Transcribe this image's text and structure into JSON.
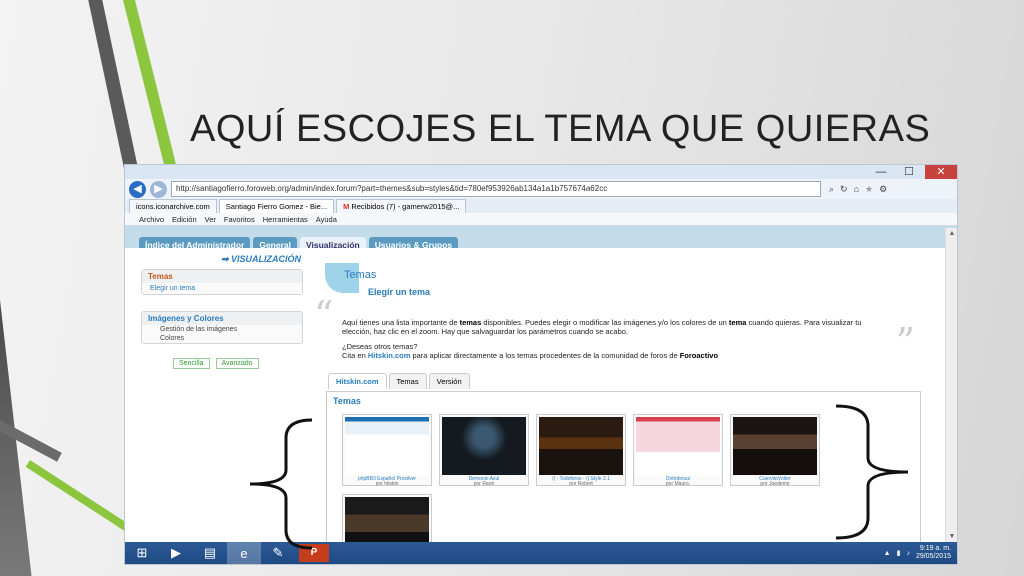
{
  "slide": {
    "title": "AQUÍ ESCOJES EL TEMA QUE QUIERAS"
  },
  "browser": {
    "window_controls": {
      "minimize": "—",
      "maximize": "☐",
      "close": "✕"
    },
    "url": "http://santiagofierro.foroweb.org/admin/index.forum?part=themes&sub=styles&tid=780ef953926ab134a1a1b757674a62cc",
    "tabs": [
      {
        "label": "icons.iconarchive.com",
        "active": false
      },
      {
        "label": "Santiago Fierro Gomez - Bie...",
        "active": true
      },
      {
        "label": "Recibidos (7) - gamerw2015@...",
        "active": false
      }
    ],
    "menu": [
      "Archivo",
      "Edición",
      "Ver",
      "Favoritos",
      "Herramientas",
      "Ayuda"
    ]
  },
  "admin": {
    "tabs": [
      "Índice del Administrador",
      "General",
      "Visualización",
      "Usuarios & Grupos"
    ],
    "active_tab": "Visualización",
    "sidebar": {
      "section": "➡ VISUALIZACIÓN",
      "group1": {
        "title": "Temas",
        "items": [
          "Elegir un tema"
        ]
      },
      "group2": {
        "title": "Imágenes y Colores",
        "items": [
          "Gestión de las imágenes",
          "Colores"
        ]
      },
      "modes": [
        "Sencilla",
        "Avanzado"
      ]
    },
    "content": {
      "title": "Temas",
      "subtitle": "Elegir un tema",
      "para1_a": "Aquí tienes una lista importante de ",
      "para1_b": "temas",
      "para1_c": " disponibles. Puedes elegir o modificar las imágenes y/o los colores de un ",
      "para1_d": "tema",
      "para1_e": " cuando quieras. Para visualizar tu elección, haz clic en el zoom. Hay que salvaguardar los parámetros cuando se acabo.",
      "para2_line1": "¿Deseas otros temas?",
      "para2_a": "Cita en ",
      "para2_b": "Hitskin.com",
      "para2_c": " para aplicar directamente a los temas procedentes de la comunidad de foros de ",
      "para2_d": "Foroactivo",
      "theme_tabs": [
        "Hitskin.com",
        "Temas",
        "Versión"
      ],
      "panel_title": "Temas",
      "themes": [
        {
          "name": "phpBB3 Español Prosilver",
          "by": "por hitskin",
          "style": "light"
        },
        {
          "name": "Demonio Azul",
          "by": "por Raori",
          "style": "dark1"
        },
        {
          "name": "/) - Todoforos - /) Style 3.1",
          "by": "por Robert",
          "style": "dark2"
        },
        {
          "name": "Dnitrdeous",
          "by": "por Mauro.",
          "style": "pink"
        },
        {
          "name": "CuervitoVolter",
          "by": "por Joedemo",
          "style": "dark3"
        },
        {
          "name": "",
          "by": "",
          "style": "dark4"
        }
      ]
    }
  },
  "taskbar": {
    "time": "9:19 a. m.",
    "date": "29/05/2015"
  }
}
